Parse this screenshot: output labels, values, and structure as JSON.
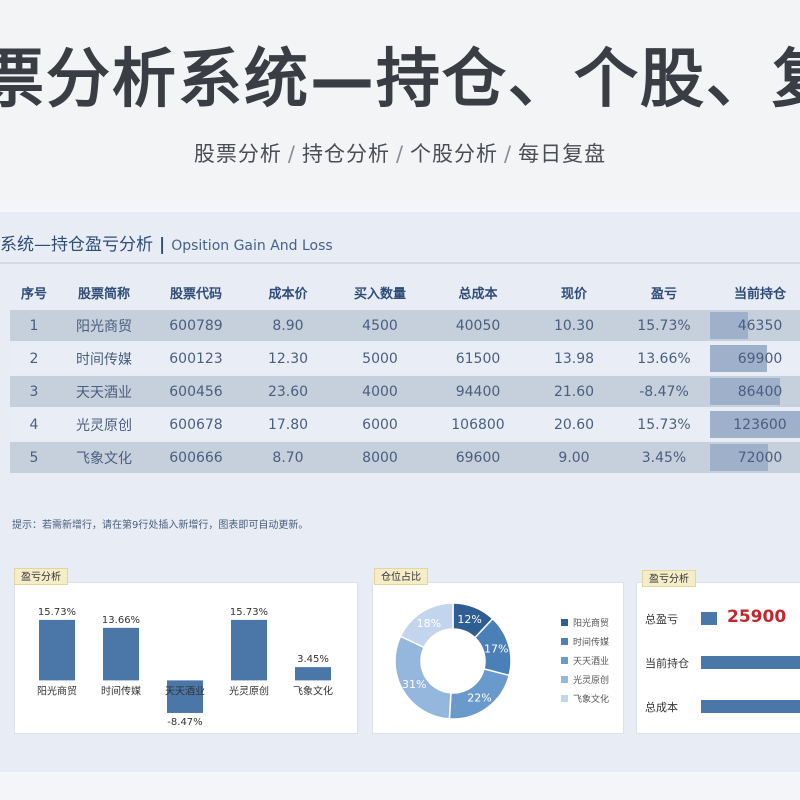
{
  "banner": {
    "title": "票分析系统—持仓、个股、复",
    "breadcrumbs": [
      "股票分析",
      "持仓分析",
      "个股分析",
      "每日复盘"
    ],
    "separator": "/"
  },
  "panel": {
    "title": "系统—持仓盈亏分析",
    "title_sep": "|",
    "subtitle": "Opsition Gain And Loss",
    "hint": "提示：若需新增行，请在第9行处插入新增行，图表即可自动更新。"
  },
  "table": {
    "headers": [
      "序号",
      "股票简称",
      "股票代码",
      "成本价",
      "买入数量",
      "总成本",
      "现价",
      "盈亏",
      "当前持仓"
    ],
    "rows": [
      [
        "1",
        "阳光商贸",
        "600789",
        "8.90",
        "4500",
        "40050",
        "10.30",
        "15.73%",
        "46350"
      ],
      [
        "2",
        "时间传媒",
        "600123",
        "12.30",
        "5000",
        "61500",
        "13.98",
        "13.66%",
        "69900"
      ],
      [
        "3",
        "天天酒业",
        "600456",
        "23.60",
        "4000",
        "94400",
        "21.60",
        "-8.47%",
        "86400"
      ],
      [
        "4",
        "光灵原创",
        "600678",
        "17.80",
        "6000",
        "106800",
        "20.60",
        "15.73%",
        "123600"
      ],
      [
        "5",
        "飞象文化",
        "600666",
        "8.70",
        "8000",
        "69600",
        "9.00",
        "3.45%",
        "72000"
      ]
    ],
    "position_max": 123600
  },
  "colors": {
    "bar": "#4a77a8",
    "summary_value": "#c0282d",
    "donut": [
      "#2f5e94",
      "#4a7fb7",
      "#6a9acb",
      "#95b6dd",
      "#c3d5ec"
    ]
  },
  "cards": {
    "pnl_tag": "盈亏分析",
    "share_tag": "仓位占比",
    "summary_tag": "盈亏分析"
  },
  "chart_data": [
    {
      "type": "bar",
      "categories": [
        "阳光商贸",
        "时间传媒",
        "天天酒业",
        "光灵原创",
        "飞象文化"
      ],
      "values": [
        15.73,
        13.66,
        -8.47,
        15.73,
        3.45
      ],
      "data_labels": [
        "15.73%",
        "13.66%",
        "-8.47%",
        "15.73%",
        "3.45%"
      ],
      "title": "",
      "ylim": [
        -9,
        17
      ],
      "grid": false
    },
    {
      "type": "pie",
      "categories": [
        "阳光商贸",
        "时间传媒",
        "天天酒业",
        "光灵原创",
        "飞象文化"
      ],
      "values": [
        12,
        17,
        22,
        31,
        18
      ],
      "data_labels": [
        "12%",
        "17%",
        "22%",
        "31%",
        "18%"
      ],
      "legend": "right"
    },
    {
      "type": "bar",
      "orientation": "horizontal",
      "categories": [
        "总盈亏",
        "当前持仓",
        "总成本"
      ],
      "values": [
        25900,
        398250,
        372350
      ],
      "data_labels": [
        "25900"
      ]
    }
  ]
}
